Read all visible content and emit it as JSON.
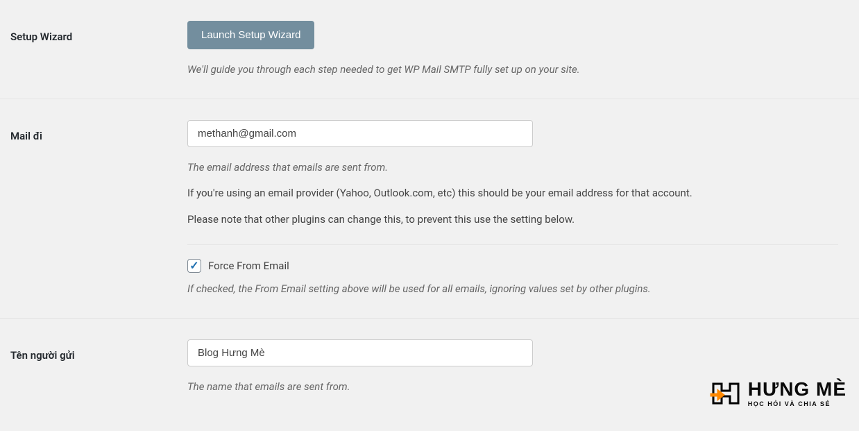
{
  "setup_wizard": {
    "label": "Setup Wizard",
    "button_label": "Launch Setup Wizard",
    "description": "We'll guide you through each step needed to get WP Mail SMTP fully set up on your site."
  },
  "from_email": {
    "label": "Mail đi",
    "value": "methanh@gmail.com",
    "desc_italic": "The email address that emails are sent from.",
    "desc_line1": "If you're using an email provider (Yahoo, Outlook.com, etc) this should be your email address for that account.",
    "desc_line2": "Please note that other plugins can change this, to prevent this use the setting below.",
    "force_checked": true,
    "force_label": "Force From Email",
    "force_desc": "If checked, the From Email setting above will be used for all emails, ignoring values set by other plugins."
  },
  "from_name": {
    "label": "Tên người gửi",
    "value": "Blog Hưng Mè",
    "desc_italic": "The name that emails are sent from."
  },
  "brand": {
    "title": "HƯNG MÈ",
    "subtitle": "HỌC HỎI VÀ CHIA SẺ"
  }
}
